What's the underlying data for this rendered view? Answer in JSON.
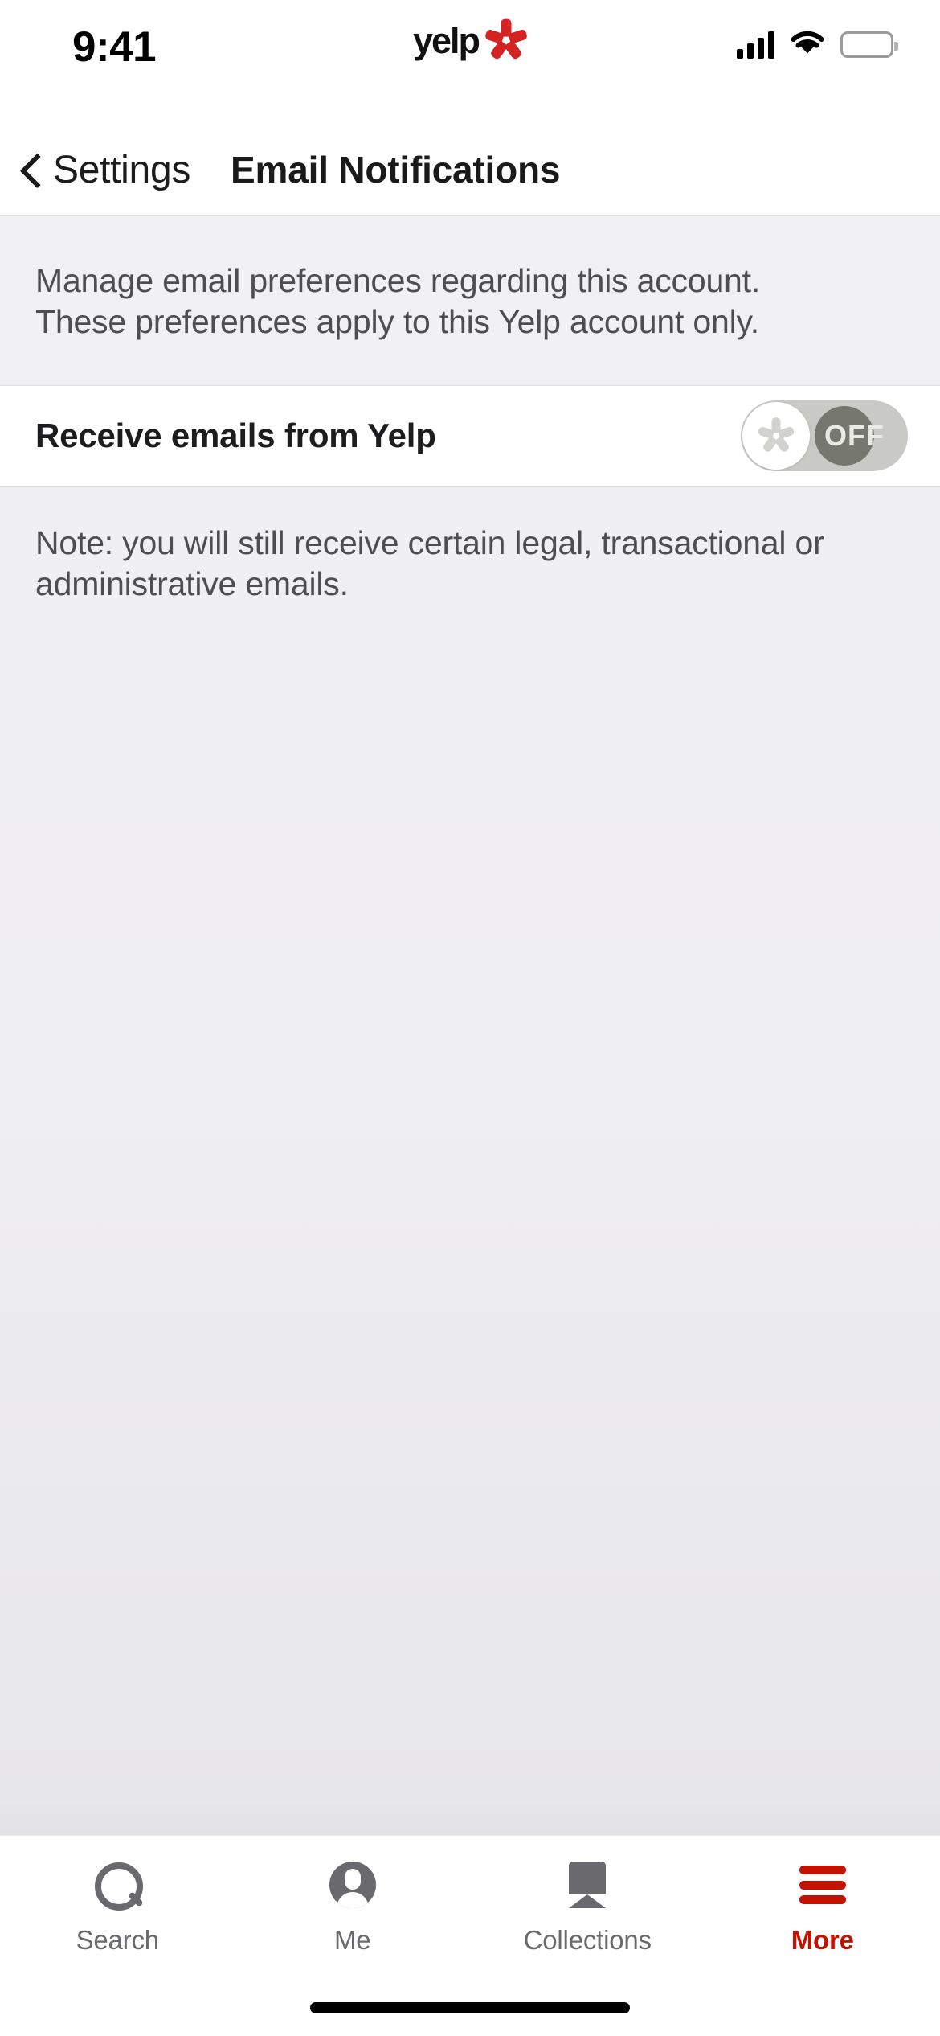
{
  "status_bar": {
    "time": "9:41",
    "brand": "yelp",
    "icons": {
      "signal": "signal-bars-icon",
      "wifi": "wifi-icon",
      "battery": "battery-icon"
    }
  },
  "nav": {
    "back_label": "Settings",
    "back_icon": "chevron-left-icon",
    "title": "Email Notifications"
  },
  "intro": {
    "line1": "Manage email preferences regarding this account.",
    "line2": "These preferences apply to this Yelp account only."
  },
  "preference": {
    "label": "Receive emails from Yelp",
    "toggle_state": "OFF",
    "toggle_on": false,
    "knob_icon": "yelp-burst-icon"
  },
  "note": {
    "line1": "Note: you will still receive certain legal, transactional or",
    "line2": "administrative emails."
  },
  "tabbar": {
    "tabs": [
      {
        "label": "Search",
        "icon": "search-icon",
        "active": false
      },
      {
        "label": "Me",
        "icon": "person-circle-icon",
        "active": false
      },
      {
        "label": "Collections",
        "icon": "bookmark-icon",
        "active": false
      },
      {
        "label": "More",
        "icon": "hamburger-menu-icon",
        "active": true
      }
    ]
  },
  "colors": {
    "brand_red": "#d32323",
    "active_red": "#c41200",
    "page_background": "#f1f0f2",
    "row_background": "#ffffff",
    "body_text": "#4e4d52",
    "toggle_track": "#c9cac5",
    "toggle_dark_circle": "#76776f"
  }
}
